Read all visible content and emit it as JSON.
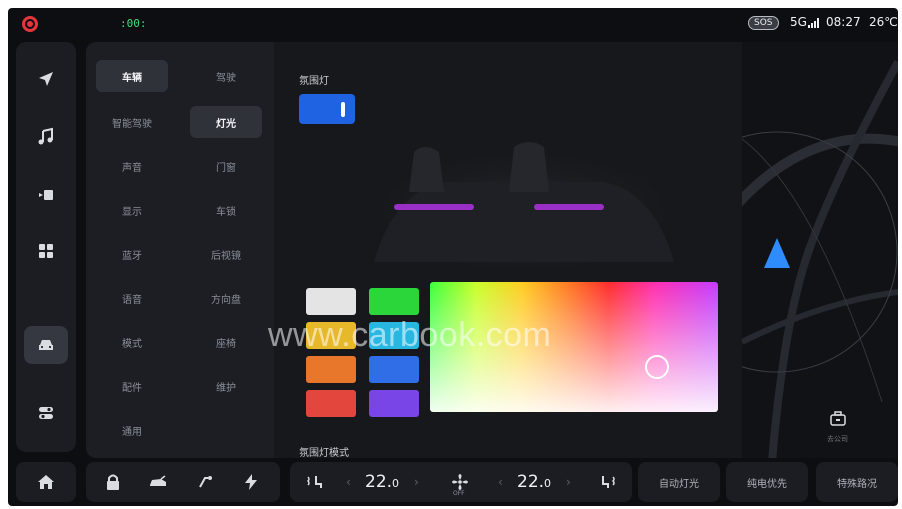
{
  "status_bar": {
    "light_indicator": ":00:",
    "sos_label": "SOS",
    "network": "5G",
    "time": "08:27",
    "temperature": "26℃"
  },
  "dock": {
    "items": [
      {
        "name": "navigation-icon"
      },
      {
        "name": "music-icon"
      },
      {
        "name": "media-icon"
      },
      {
        "name": "apps-grid-icon"
      },
      {
        "name": "car-icon"
      },
      {
        "name": "controls-icon"
      }
    ],
    "active": "car-icon"
  },
  "menu": {
    "left": [
      "车辆",
      "智能驾驶",
      "声音",
      "显示",
      "蓝牙",
      "语音",
      "模式",
      "配件",
      "通用"
    ],
    "right": [
      "驾驶",
      "灯光",
      "门窗",
      "车锁",
      "后视镜",
      "方向盘",
      "座椅",
      "维护"
    ],
    "selected_left": "车辆",
    "selected_right": "灯光"
  },
  "content": {
    "section_title": "氛围灯",
    "toggle_on": true,
    "swatches": [
      "#e4e4e4",
      "#2ad63a",
      "#e7b82a",
      "#27b7e0",
      "#e8762b",
      "#2f6ee6",
      "#e2463d",
      "#7a45e6"
    ],
    "mode_title": "氛围灯模式"
  },
  "map": {
    "destination_label": "去公司"
  },
  "bottom_bar": {
    "temp_left": "22.",
    "temp_left_decimal": "0",
    "temp_right": "22.",
    "temp_right_decimal": "0",
    "fan_state": "OFF",
    "quick_buttons": [
      "自动灯光",
      "纯电优先",
      "特殊路况"
    ]
  },
  "watermark": "www.carbook.com",
  "colors": {
    "accent_blue": "#1f63e3",
    "background": "#0d0e12",
    "panel": "#1c1e23"
  }
}
